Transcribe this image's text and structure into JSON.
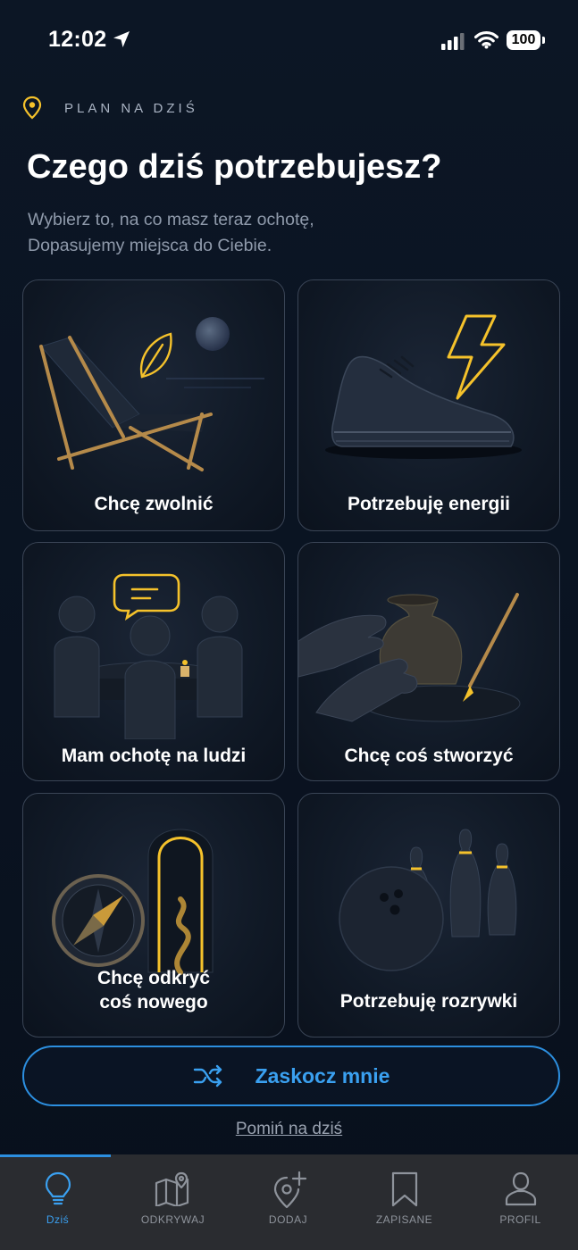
{
  "status_bar": {
    "time": "12:02",
    "battery": "100"
  },
  "header": {
    "eyebrow": "PLAN NA DZIŚ",
    "title": "Czego dziś potrzebujesz?",
    "subtitle_line1": "Wybierz to, na co masz teraz ochotę,",
    "subtitle_line2": "Dopasujemy miejsca do Ciebie."
  },
  "cards": [
    {
      "label": "Chcę zwolnić",
      "icon": "deck-chair-leaf"
    },
    {
      "label": "Potrzebuję energii",
      "icon": "sneaker-lightning"
    },
    {
      "label": "Mam ochotę na ludzi",
      "icon": "people-table-chat"
    },
    {
      "label": "Chcę coś stworzyć",
      "icon": "pottery-brush"
    },
    {
      "label_line1": "Chcę odkryć",
      "label_line2": "coś nowego",
      "icon": "compass-doorway"
    },
    {
      "label": "Potrzebuję rozrywki",
      "icon": "bowling"
    }
  ],
  "actions": {
    "surprise": "Zaskocz mnie",
    "skip": "Pomiń na dziś"
  },
  "tabs": [
    {
      "label": "Dziś",
      "icon": "lightbulb-icon",
      "active": true
    },
    {
      "label": "ODKRYWAJ",
      "icon": "map-icon",
      "active": false
    },
    {
      "label": "DODAJ",
      "icon": "add-location-icon",
      "active": false
    },
    {
      "label": "ZAPISANE",
      "icon": "bookmark-icon",
      "active": false
    },
    {
      "label": "PROFIL",
      "icon": "user-icon",
      "active": false
    }
  ],
  "colors": {
    "background": "#0b1422",
    "accent_blue": "#2c8fe0",
    "accent_gold": "#f5c22b",
    "tabbar": "#2a2c30"
  }
}
